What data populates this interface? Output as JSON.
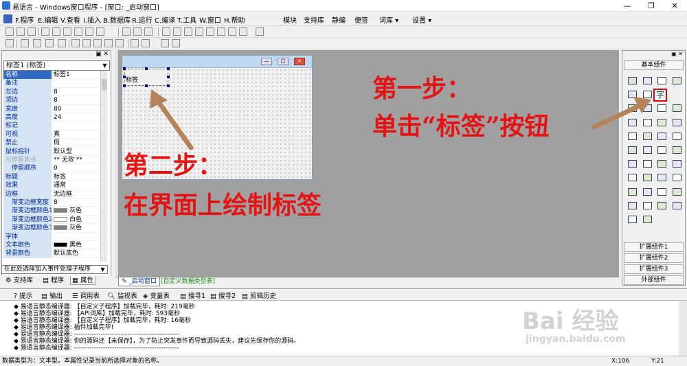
{
  "window": {
    "title": "易语言 - Windows窗口程序 - [窗口: _启动窗口]",
    "minimize": "—",
    "restore": "❐",
    "close": "✕"
  },
  "menu": {
    "items": [
      "F.程序",
      "E.编辑",
      "V.查看",
      "I.插入",
      "B.数据库",
      "R.运行",
      "C.编译",
      "T.工具",
      "W.窗口",
      "H.帮助"
    ],
    "right_items": [
      "模块",
      "支持库",
      "静编",
      "便签",
      "词库 ▾",
      "设置 ▾"
    ]
  },
  "left_panel": {
    "object_select": "标签1 (标签)",
    "properties": [
      {
        "name": "名称",
        "value": "标签1",
        "selected": true
      },
      {
        "name": "备注",
        "value": ""
      },
      {
        "name": "左边",
        "value": "8"
      },
      {
        "name": "顶边",
        "value": "8"
      },
      {
        "name": "宽度",
        "value": "80"
      },
      {
        "name": "高度",
        "value": "24"
      },
      {
        "name": "标记",
        "value": ""
      },
      {
        "name": "可视",
        "value": "真"
      },
      {
        "name": "禁止",
        "value": "假"
      },
      {
        "name": "鼠标指针",
        "value": "默认型"
      },
      {
        "name": "可停留焦点",
        "value": "** 无效 **",
        "dim": true
      },
      {
        "name": "停留顺序",
        "value": "0",
        "sub": true
      },
      {
        "name": "标题",
        "value": "标签"
      },
      {
        "name": "效果",
        "value": "通常"
      },
      {
        "name": "边框",
        "value": "无边框"
      },
      {
        "name": "渐变边框宽度",
        "value": "8",
        "sub": true
      },
      {
        "name": "渐变边框颜色1",
        "value": "灰色",
        "sub": true,
        "swatch": "#808080"
      },
      {
        "name": "渐变边框颜色2",
        "value": "白色",
        "sub": true,
        "swatch": "#ffffff"
      },
      {
        "name": "渐变边框颜色3",
        "value": "灰色",
        "sub": true,
        "swatch": "#808080"
      },
      {
        "name": "字体",
        "value": ""
      },
      {
        "name": "文本颜色",
        "value": "黑色",
        "swatch": "#000000"
      },
      {
        "name": "背景颜色",
        "value": "默认底色"
      }
    ],
    "event_select": "在此处选择加入事件处理子程序",
    "tabs": [
      "支持库",
      "程序",
      "属性"
    ]
  },
  "designer": {
    "label_text": "标签",
    "tabs": [
      "_启动窗口",
      "[自定义数据类型表]"
    ]
  },
  "right_panel": {
    "basic": "基本组件",
    "tool_label_glyph": "字",
    "ext1": "扩展组件1",
    "ext2": "扩展组件2",
    "ext3": "扩展组件3",
    "external": "外部组件"
  },
  "bottom": {
    "tabs": [
      "提示",
      "输出",
      "调用表",
      "监视表",
      "变量表",
      "搜寻1",
      "搜寻2",
      "剪辑历史"
    ],
    "log": [
      "◆ 易语言静态编译器: 【自定义子程序】加载完毕，耗时: 219毫秒",
      "◆ 易语言静态编译器: 【API词库】加载完毕，耗时: 593毫秒",
      "◆ 易语言静态编译器: 【自定义子程序】加载完毕，耗时: 16毫秒",
      "◆ 易语言静态编译器: 插件加载完毕!",
      "◆ 易语言静态编译器: -----------------------------------------------",
      "◆ 易语言静态编译器: 你的源码还【未保存】，为了防止突发事件而导致源码丢失，建议先保存你的源码。",
      "◆ 易语言静态编译器: -----------------------------------------------"
    ]
  },
  "status": {
    "text": "数据类型为：文本型。本属性记录当前所选择对象的名称。",
    "x": "X:106",
    "y": "Y:21"
  },
  "annotations": {
    "step1_title": "第一步：",
    "step1_desc": "单击“标签”按钮",
    "step2_title": "第二步：",
    "step2_desc": "在界面上绘制标签",
    "arrow_color": "#b5835a",
    "text_color": "#e41414"
  },
  "watermark": {
    "brand": "Bai 经验",
    "url": "jingyan.baidu.com"
  }
}
